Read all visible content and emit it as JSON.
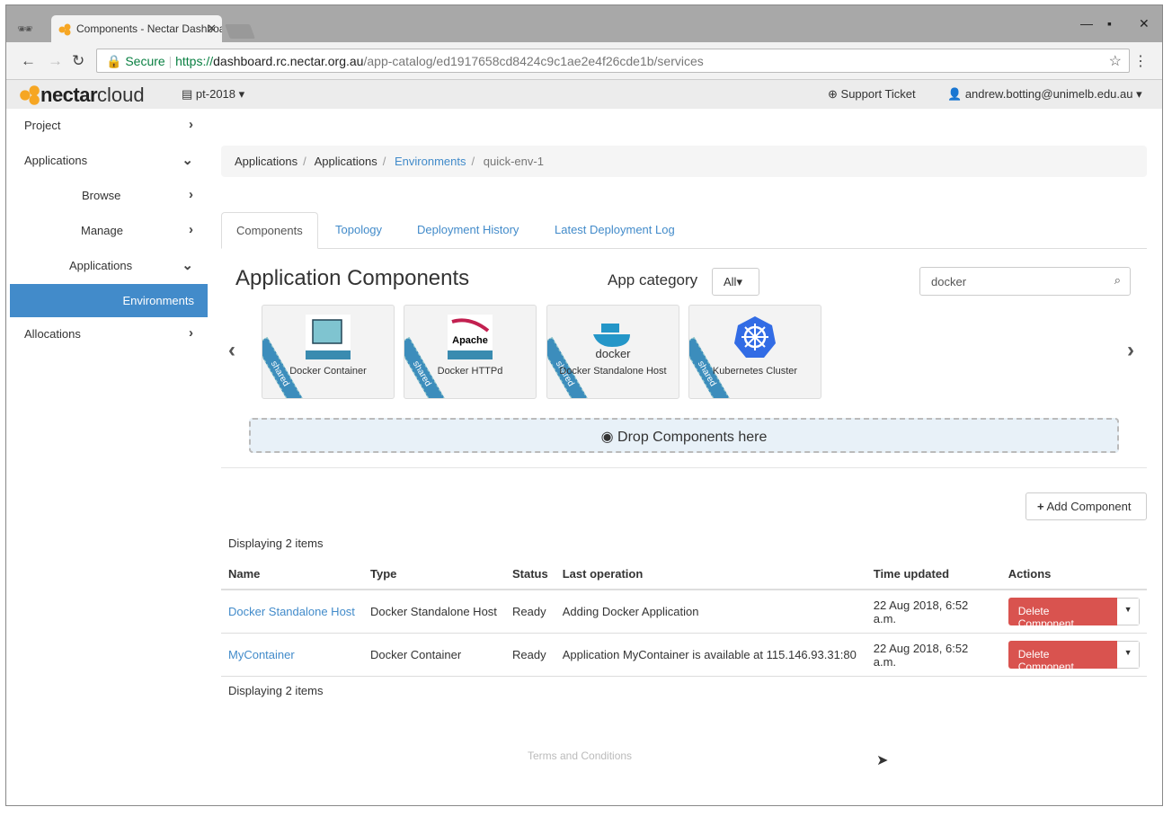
{
  "browser": {
    "tab_title": "Components - Nectar Dashboard",
    "secure_label": "Secure",
    "url_scheme": "https://",
    "url_host": "dashboard.rc.nectar.org.au",
    "url_path": "/app-catalog/ed1917658cd8424c9c1ae2e4f26cde1b/services"
  },
  "header": {
    "logo_bold": "nectar",
    "logo_light": "cloud",
    "project": "pt-2018",
    "support": "Support Ticket",
    "user": "andrew.botting@unimelb.edu.au"
  },
  "sidebar": {
    "items": [
      {
        "label": "Project"
      },
      {
        "label": "Applications"
      },
      {
        "label": "Browse"
      },
      {
        "label": "Manage"
      },
      {
        "label": "Applications"
      },
      {
        "label": "Environments"
      },
      {
        "label": "Allocations"
      }
    ]
  },
  "breadcrumb": [
    "Applications",
    "Applications",
    "Environments",
    "quick-env-1"
  ],
  "tabs": [
    "Components",
    "Topology",
    "Deployment History",
    "Latest Deployment Log"
  ],
  "components": {
    "title": "Application Components",
    "category_label": "App category",
    "category_value": "All",
    "search_value": "docker",
    "drop_label": "Drop Components here",
    "ribbon": "shared",
    "cards": [
      {
        "name": "Docker Container",
        "icon": "docker-container"
      },
      {
        "name": "Docker HTTPd",
        "icon": "apache-docker"
      },
      {
        "name": "Docker Standalone Host",
        "icon": "docker-whale"
      },
      {
        "name": "Kubernetes Cluster",
        "icon": "kubernetes"
      }
    ]
  },
  "table": {
    "add_label": "Add Component",
    "count": "Displaying 2 items",
    "headers": [
      "Name",
      "Type",
      "Status",
      "Last operation",
      "Time updated",
      "Actions"
    ],
    "rows": [
      {
        "name": "Docker Standalone Host",
        "type": "Docker Standalone Host",
        "status": "Ready",
        "op": "Adding Docker Application",
        "time": "22 Aug 2018, 6:52 a.m.",
        "action": "Delete Component"
      },
      {
        "name": "MyContainer",
        "type": "Docker Container",
        "status": "Ready",
        "op": "Application MyContainer is available at 115.146.93.31:80",
        "time": "22 Aug 2018, 6:52 a.m.",
        "action": "Delete Component"
      }
    ]
  },
  "footer": {
    "terms": "Terms and Conditions"
  },
  "colors": {
    "accent": "#428bca",
    "danger": "#d9534f",
    "logo": "#f6a623"
  }
}
